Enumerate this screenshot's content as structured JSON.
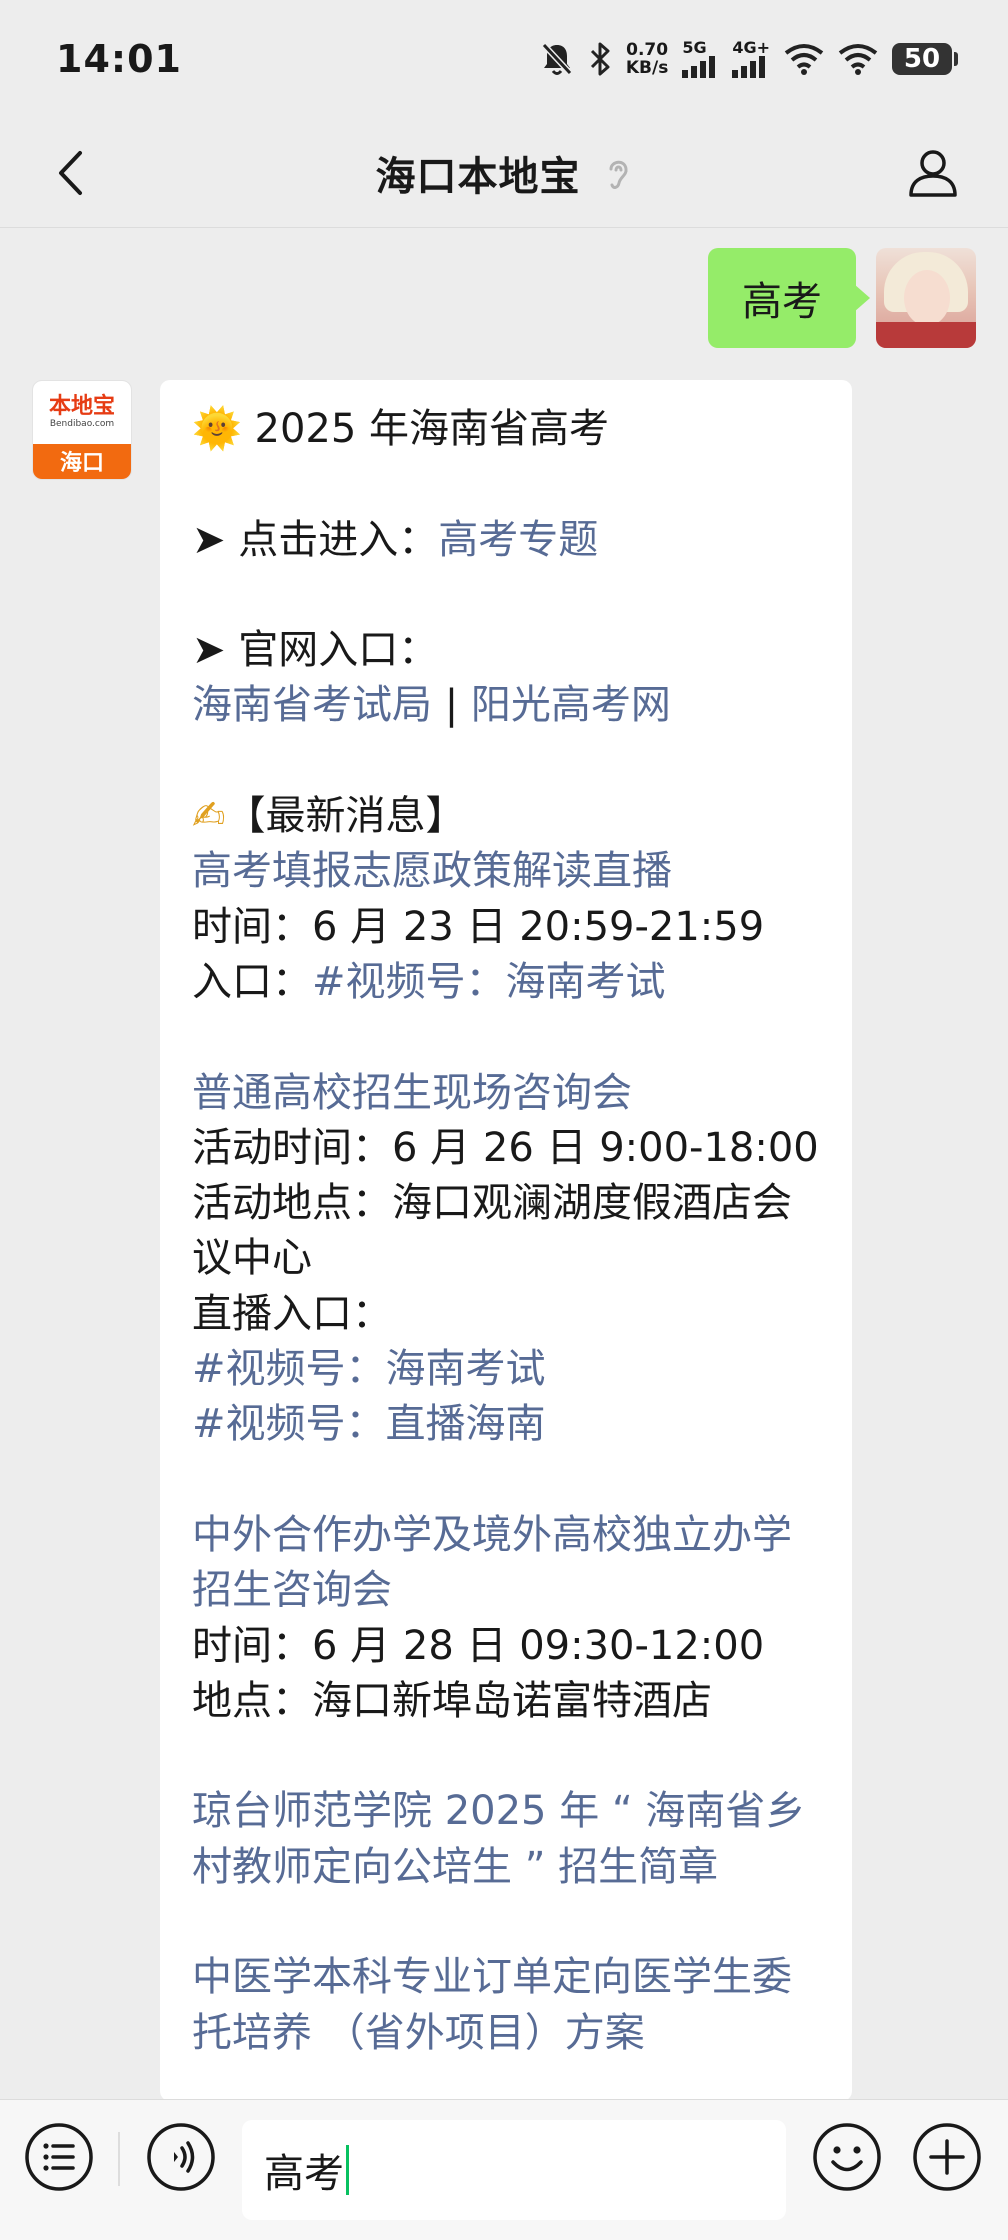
{
  "status_bar": {
    "time": "14:01",
    "speed_value": "0.70",
    "speed_unit": "KB/s",
    "network_1": "5G",
    "network_2": "4G+",
    "battery": "50"
  },
  "nav": {
    "title": "海口本地宝"
  },
  "outgoing_message": {
    "text": "高考"
  },
  "bot_avatar": {
    "logo_text": "本地宝",
    "logo_sub": "Bendibao.com",
    "city": "海口"
  },
  "reply": {
    "heading_emoji": "🌞",
    "heading": "2025 年海南省高考",
    "entry_prefix": "➤ 点击进入：",
    "entry_link": "高考专题",
    "official_prefix": "➤ 官网入口：",
    "official_link_1": "海南省考试局",
    "official_separator": " | ",
    "official_link_2": "阳光高考网",
    "news_emoji": "✍",
    "news_heading": "【最新消息】",
    "item1_title": "高考填报志愿政策解读直播",
    "item1_time": "时间：6 月 23 日 20:59-21:59",
    "item1_entry_label": "入口：",
    "item1_entry_link": "#视频号：海南考试",
    "item2_title": "普通高校招生现场咨询会",
    "item2_time": "活动时间：6 月 26 日 9:00-18:00",
    "item2_place": "活动地点：海口观澜湖度假酒店会议中心",
    "item2_live_label": "直播入口：",
    "item2_live_link_1": "#视频号：海南考试",
    "item2_live_link_2": "#视频号：直播海南",
    "item3_title": "中外合作办学及境外高校独立办学招生咨询会",
    "item3_time": "时间：6 月 28 日 09:30-12:00",
    "item3_place": "地点：海口新埠岛诺富特酒店",
    "item4_title": "琼台师范学院 2025 年 “ 海南省乡村教师定向公培生 ” 招生简章",
    "item5_title": "中医学本科专业订单定向医学生委托培养 （省外项目）方案"
  },
  "input_bar": {
    "text": "高考"
  },
  "colors": {
    "link": "#576b95",
    "bubble_out": "#95ec69",
    "caret": "#07c160"
  }
}
